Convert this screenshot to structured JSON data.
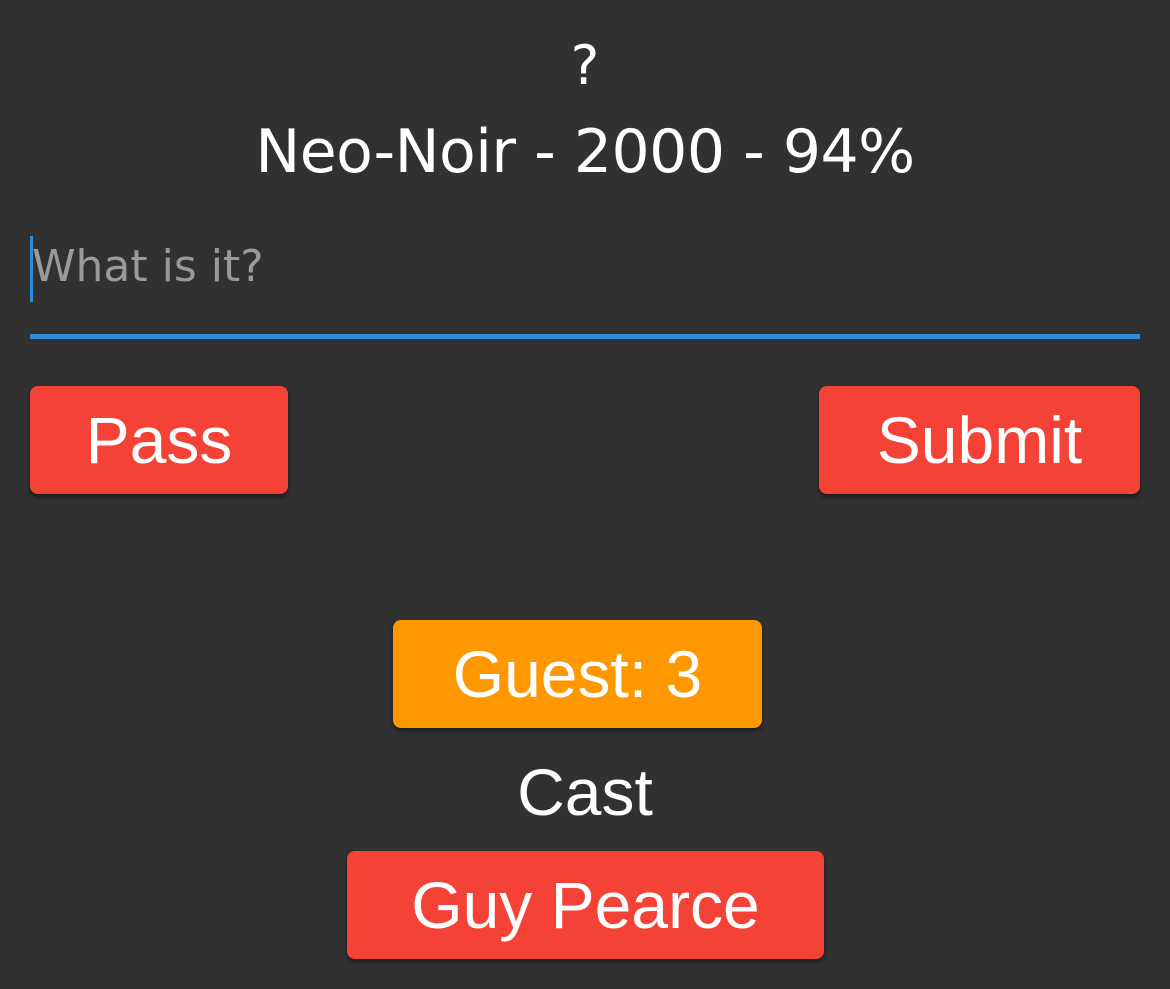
{
  "header": {
    "mystery_title": "?",
    "subtitle": "Neo-Noir - 2000 - 94%"
  },
  "guess": {
    "value": "",
    "placeholder": "What is it?"
  },
  "actions": {
    "pass_label": "Pass",
    "submit_label": "Submit"
  },
  "player": {
    "guest_label": "Guest: 3"
  },
  "cast": {
    "heading": "Cast",
    "members": [
      "Guy Pearce"
    ]
  },
  "colors": {
    "background": "#313131",
    "primary_button": "#f44336",
    "guest_button": "#ff9800",
    "input_accent": "#2b8ce0",
    "placeholder": "#9a9a9a",
    "text": "#ffffff"
  }
}
